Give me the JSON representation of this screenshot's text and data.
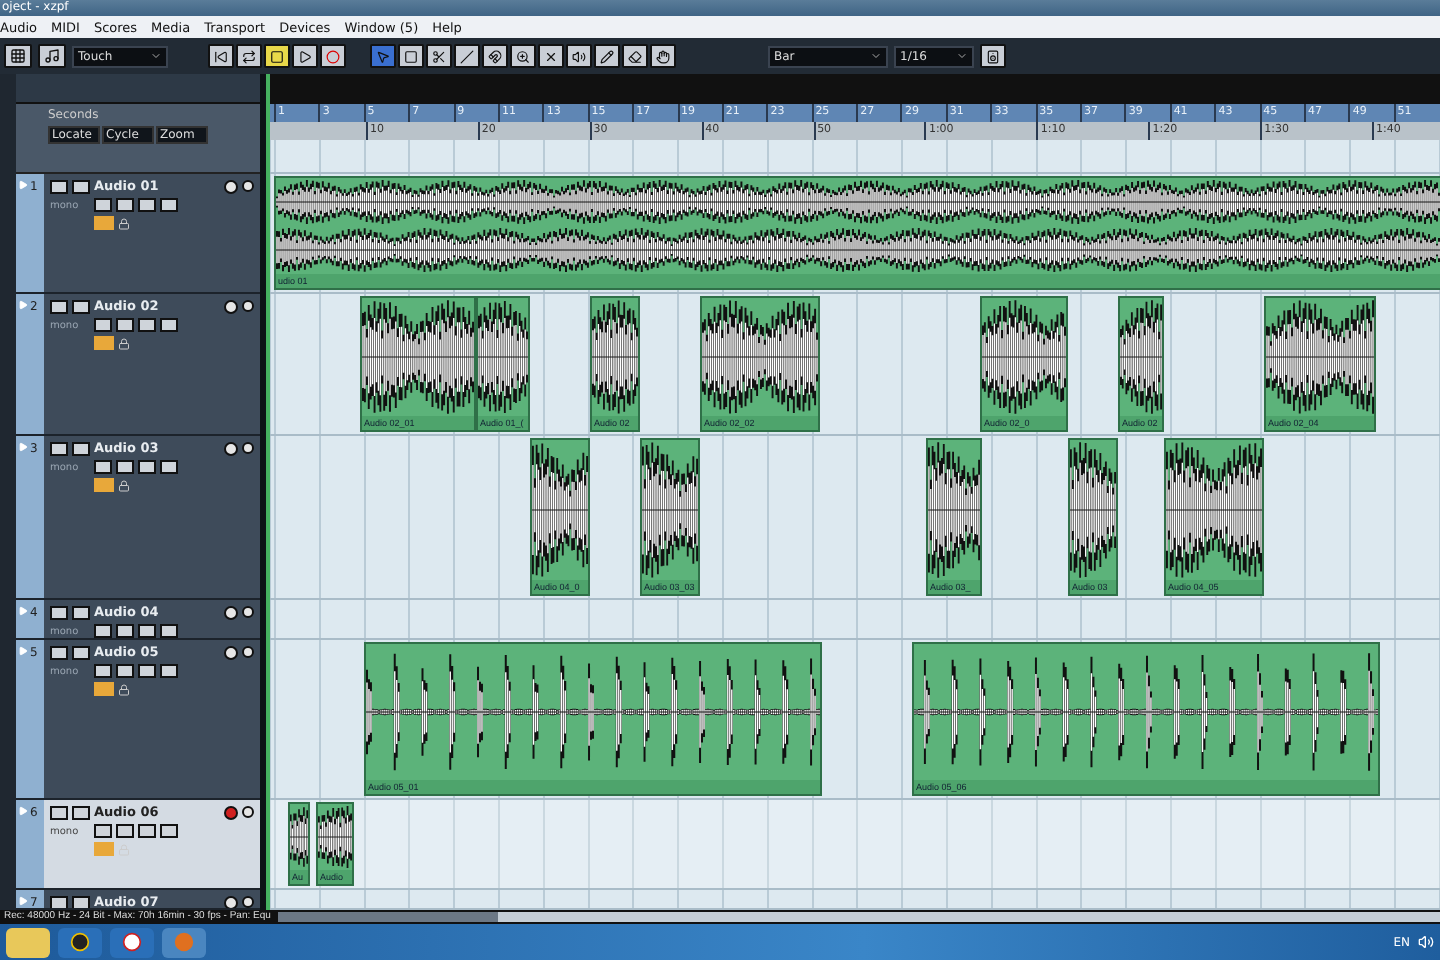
{
  "window": {
    "title": "oject - xzpf"
  },
  "menu": [
    "Audio",
    "MIDI",
    "Scores",
    "Media",
    "Transport",
    "Devices",
    "Window (5)",
    "Help"
  ],
  "toolbar": {
    "automation_mode": "Touch",
    "transport": [
      {
        "active": false
      },
      {
        "active": false
      },
      {
        "active": true
      },
      {
        "active": false
      },
      {
        "active": false
      }
    ],
    "tools": [
      {
        "selected": true
      },
      {
        "selected": false
      },
      {
        "selected": false
      },
      {
        "selected": false
      },
      {
        "selected": false
      },
      {
        "selected": false
      },
      {
        "selected": false
      },
      {
        "selected": false
      },
      {
        "selected": false
      },
      {
        "selected": false
      },
      {
        "selected": false
      }
    ],
    "grid": "Bar",
    "quantize": "1/16"
  },
  "track_list": {
    "time_format": "Seconds",
    "dropdowns": [
      "Locate",
      "Cycle",
      "Zoom"
    ]
  },
  "ruler": {
    "bars": [
      "1",
      "3",
      "5",
      "7",
      "9",
      "11",
      "13",
      "15",
      "17",
      "19",
      "21",
      "23",
      "25",
      "27",
      "29",
      "31",
      "33",
      "35",
      "37",
      "39",
      "41",
      "43",
      "45",
      "47",
      "49",
      "51"
    ],
    "time": [
      "10",
      "20",
      "30",
      "40",
      "50",
      "1:00",
      "1:10",
      "1:20",
      "1:30",
      "1:40"
    ]
  },
  "tracks": [
    {
      "number": "1",
      "name": "Audio 01",
      "channel": "mono",
      "selected": false,
      "record_enabled": false,
      "clips": [
        {
          "label": "udio 01"
        }
      ]
    },
    {
      "number": "2",
      "name": "Audio 02",
      "channel": "mono",
      "selected": false,
      "record_enabled": false,
      "clips": [
        {
          "label": "Audio 02_01"
        },
        {
          "label": "Audio 01_("
        },
        {
          "label": "Audio 02"
        },
        {
          "label": "Audio 02_02"
        },
        {
          "label": "Audio 02_0"
        },
        {
          "label": "Audio 02"
        },
        {
          "label": "Audio 02_04"
        }
      ]
    },
    {
      "number": "3",
      "name": "Audio 03",
      "channel": "mono",
      "selected": false,
      "record_enabled": false,
      "clips": [
        {
          "label": "Audio 04_0"
        },
        {
          "label": "Audio 03_03"
        },
        {
          "label": "Audio 03_"
        },
        {
          "label": "Audio 03"
        },
        {
          "label": "Audio 04_05"
        }
      ]
    },
    {
      "number": "4",
      "name": "Audio 04",
      "channel": "mono",
      "selected": false,
      "record_enabled": false
    },
    {
      "number": "5",
      "name": "Audio 05",
      "channel": "mono",
      "selected": false,
      "record_enabled": false,
      "clips": [
        {
          "label": "Audio 05_01"
        },
        {
          "label": "Audio 05_06"
        }
      ]
    },
    {
      "number": "6",
      "name": "Audio 06",
      "channel": "mono",
      "selected": true,
      "record_enabled": true,
      "clips": [
        {
          "label": "Au"
        },
        {
          "label": "Audio"
        }
      ]
    },
    {
      "number": "7",
      "name": "Audio 07",
      "selected": false,
      "record_enabled": false
    }
  ],
  "status_bar": "Rec: 48000 Hz - 24 Bit - Max: 70h 16min - 30 fps - Pan: Equ",
  "taskbar": {
    "language": "EN"
  }
}
